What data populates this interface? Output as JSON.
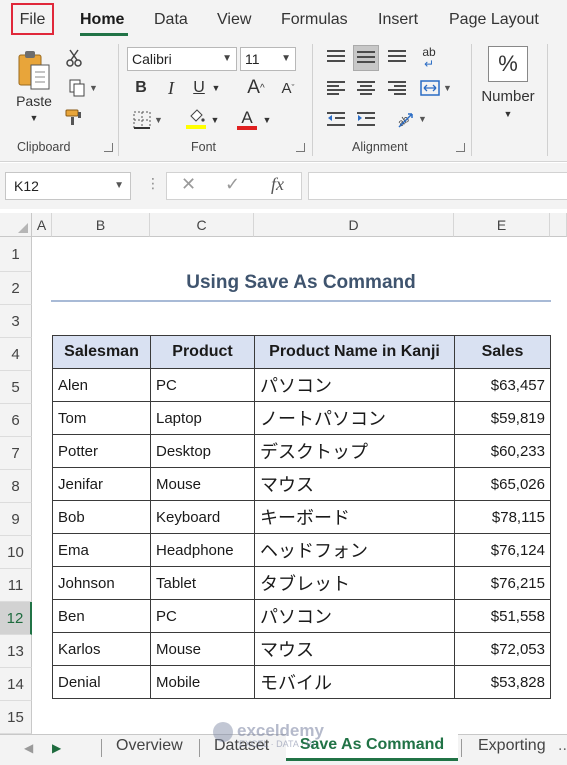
{
  "menu": {
    "file": "File",
    "home": "Home",
    "data": "Data",
    "view": "View",
    "formulas": "Formulas",
    "insert": "Insert",
    "page_layout": "Page Layout"
  },
  "ribbon": {
    "clipboard": {
      "paste_label": "Paste",
      "group_label": "Clipboard"
    },
    "font": {
      "font_name": "Calibri",
      "font_size": "11",
      "bold": "B",
      "italic": "I",
      "underline": "U",
      "grow": "A",
      "shrink": "A",
      "font_color_letter": "A",
      "group_label": "Font",
      "highlight_color": "#ffff00",
      "font_color": "#e02020"
    },
    "alignment": {
      "group_label": "Alignment",
      "wrap_icon_text": "ab"
    },
    "number": {
      "label": "Number",
      "icon_text": "%"
    }
  },
  "formula_bar": {
    "name_box": "K12",
    "cancel": "✕",
    "enter": "✓",
    "fx": "fx",
    "content": ""
  },
  "grid": {
    "columns": [
      "A",
      "B",
      "C",
      "D",
      "E"
    ],
    "rows": [
      "1",
      "2",
      "3",
      "4",
      "5",
      "6",
      "7",
      "8",
      "9",
      "10",
      "11",
      "12",
      "13",
      "14",
      "15"
    ],
    "active_row": "12"
  },
  "sheet": {
    "title": "Using Save As Command",
    "headers": [
      "Salesman",
      "Product",
      "Product Name in Kanji",
      "Sales"
    ],
    "rows": [
      [
        "Alen",
        "PC",
        "パソコン",
        "$63,457"
      ],
      [
        "Tom",
        "Laptop",
        "ノートパソコン",
        "$59,819"
      ],
      [
        "Potter",
        "Desktop",
        "デスクトップ",
        "$60,233"
      ],
      [
        "Jenifar",
        "Mouse",
        "マウス",
        "$65,026"
      ],
      [
        "Bob",
        "Keyboard",
        "キーボード",
        "$78,115"
      ],
      [
        "Ema",
        "Headphone",
        "ヘッドフォン",
        "$76,124"
      ],
      [
        "Johnson",
        "Tablet",
        "タブレット",
        "$76,215"
      ],
      [
        "Ben",
        "PC",
        "パソコン",
        "$51,558"
      ],
      [
        "Karlos",
        "Mouse",
        "マウス",
        "$72,053"
      ],
      [
        "Denial",
        "Mobile",
        "モバイル",
        "$53,828"
      ]
    ]
  },
  "tabs": {
    "items": [
      "Overview",
      "Dataset",
      "Save As Command",
      "Exporting"
    ],
    "active": "Save As Command",
    "more": "..."
  },
  "watermark": {
    "name": "exceldemy",
    "tagline": "EXCEL · DATA · BI"
  },
  "colors": {
    "accent": "#217346",
    "header_fill": "#d9e1f2",
    "file_highlight": "#e0283a",
    "title_text": "#3f546e"
  }
}
